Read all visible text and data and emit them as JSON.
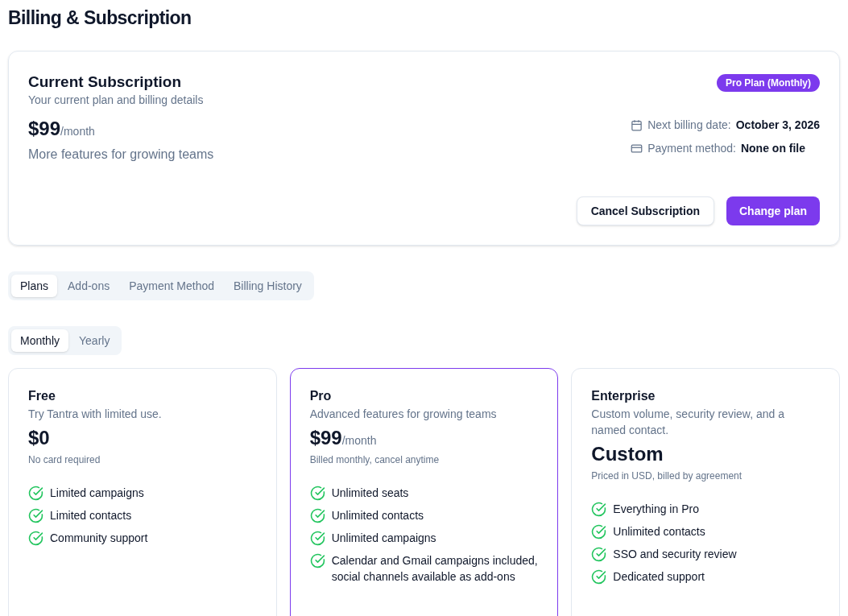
{
  "page_title": "Billing & Subscription",
  "current_subscription": {
    "title": "Current Subscription",
    "subtitle": "Your current plan and billing details",
    "badge": "Pro Plan (Monthly)",
    "price": "$99",
    "period": "/month",
    "description": "More features for growing teams",
    "details": [
      {
        "kind": "calendar",
        "label": "Next billing date:",
        "value": "October 3, 2026"
      },
      {
        "kind": "card",
        "label": "Payment method:",
        "value": "None on file"
      }
    ],
    "buttons": [
      {
        "label": "Cancel Subscription",
        "kind": "secondary"
      },
      {
        "label": "Change plan",
        "kind": "primary"
      }
    ]
  },
  "tabs": [
    {
      "label": "Plans",
      "selected": true
    },
    {
      "label": "Add-ons",
      "selected": false
    },
    {
      "label": "Payment Method",
      "selected": false
    },
    {
      "label": "Billing History",
      "selected": false
    }
  ],
  "billing_period": [
    {
      "label": "Monthly",
      "selected": true
    },
    {
      "label": "Yearly",
      "selected": false
    }
  ],
  "plans": [
    {
      "name": "Free",
      "description": "Try Tantra with limited use.",
      "price": "$0",
      "note": "No card required",
      "selected": false,
      "features": [
        "Limited campaigns",
        "Limited contacts",
        "Community support"
      ]
    },
    {
      "name": "Pro",
      "description": "Advanced features for growing teams",
      "price": "$99",
      "period": "/month",
      "note": "Billed monthly, cancel anytime",
      "selected": true,
      "features": [
        "Unlimited seats",
        "Unlimited contacts",
        "Unlimited campaigns",
        "Calendar and Gmail campaigns included, social channels available as add-ons"
      ]
    },
    {
      "name": "Enterprise",
      "description": "Custom volume, security review, and a named contact.",
      "price": "Custom",
      "note": "Priced in USD, billed by agreement",
      "selected": false,
      "features": [
        "Everything in Pro",
        "Unlimited contacts",
        "SSO and security review",
        "Dedicated support"
      ]
    }
  ]
}
